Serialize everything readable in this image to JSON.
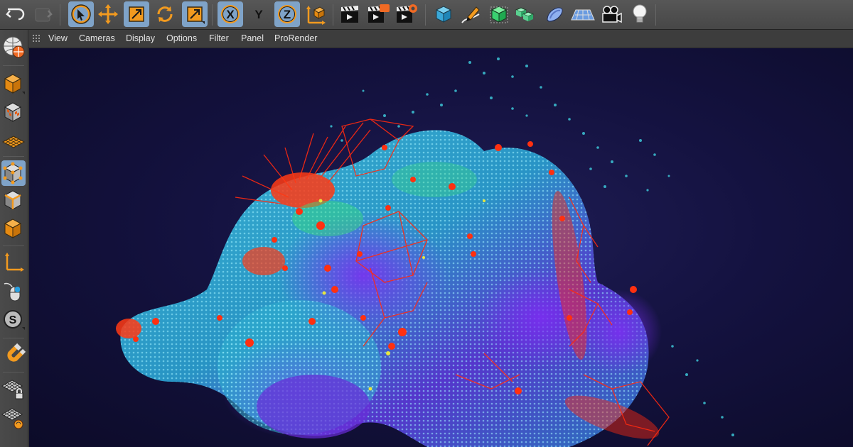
{
  "toolbar": {
    "items": [
      {
        "name": "undo-icon"
      },
      {
        "name": "redo-icon"
      },
      {
        "name": "live-selection-icon"
      },
      {
        "name": "move-icon"
      },
      {
        "name": "scale-icon"
      },
      {
        "name": "rotate-icon"
      },
      {
        "name": "recent-tools-icon"
      },
      {
        "name": "x-axis-lock-icon",
        "label": "X"
      },
      {
        "name": "y-axis-lock-icon",
        "label": "Y"
      },
      {
        "name": "z-axis-lock-icon",
        "label": "Z"
      },
      {
        "name": "coordinate-system-icon"
      },
      {
        "name": "render-view-icon"
      },
      {
        "name": "render-to-picture-viewer-icon"
      },
      {
        "name": "render-settings-icon"
      },
      {
        "name": "cube-icon"
      },
      {
        "name": "pen-spline-icon"
      },
      {
        "name": "subdivision-surface-icon"
      },
      {
        "name": "array-generator-icon"
      },
      {
        "name": "deformer-icon"
      },
      {
        "name": "floor-icon"
      },
      {
        "name": "camera-icon"
      },
      {
        "name": "light-icon"
      }
    ]
  },
  "viewport_menu": {
    "items": [
      "View",
      "Cameras",
      "Display",
      "Options",
      "Filter",
      "Panel",
      "ProRender"
    ]
  },
  "left_tools": {
    "items": [
      {
        "name": "workplane-globe-icon"
      },
      {
        "name": "model-mode-icon"
      },
      {
        "name": "texture-mode-icon"
      },
      {
        "name": "workplane-mode-icon"
      },
      {
        "name": "points-mode-icon"
      },
      {
        "name": "edges-mode-icon"
      },
      {
        "name": "polygons-mode-icon"
      },
      {
        "name": "axis-mode-icon"
      },
      {
        "name": "tweak-mode-icon"
      },
      {
        "name": "solo-icon"
      },
      {
        "name": "snap-magnet-icon"
      },
      {
        "name": "lock-workplane-icon"
      },
      {
        "name": "planar-workplane-icon"
      }
    ]
  },
  "colors": {
    "accent_active": "#7fa3c8",
    "orange": "#f29a1f",
    "viewport_bg": "#141240",
    "particle_cyan": "#2fb8d8",
    "particle_purple": "#6a2bd9",
    "particle_red": "#ff2a10"
  }
}
